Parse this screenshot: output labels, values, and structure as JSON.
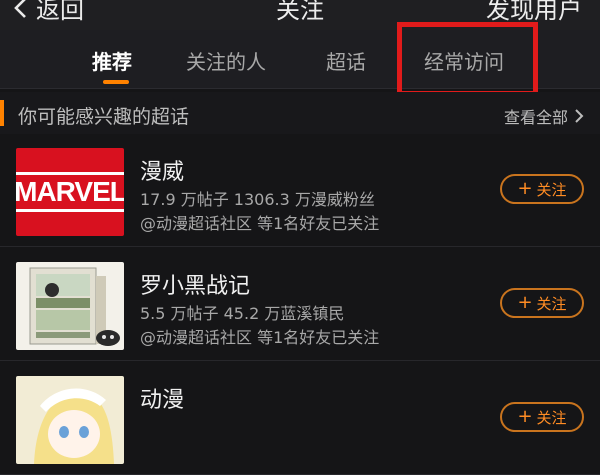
{
  "header": {
    "back_label": "返回",
    "title": "关注",
    "discover_label": "发现用户"
  },
  "tabs": [
    {
      "label": "推荐",
      "active": true
    },
    {
      "label": "关注的人",
      "active": false
    },
    {
      "label": "超话",
      "active": false
    },
    {
      "label": "经常访问",
      "active": false
    }
  ],
  "section": {
    "title": "你可能感兴趣的超话",
    "more_label": "查看全部"
  },
  "items": [
    {
      "name": "漫威",
      "stats": "17.9 万帖子 1306.3 万漫威粉丝",
      "social": "@动漫超话社区 等1名好友已关注",
      "follow_label": "关注",
      "thumb_text": "MARVEL"
    },
    {
      "name": "罗小黑战记",
      "stats": "5.5 万帖子 45.2 万蓝溪镇民",
      "social": "@动漫超话社区 等1名好友已关注",
      "follow_label": "关注",
      "thumb_text": ""
    },
    {
      "name": "动漫",
      "stats": "",
      "social": "",
      "follow_label": "关注",
      "thumb_text": ""
    }
  ],
  "colors": {
    "accent": "#ff8200",
    "highlight": "#e11b1b",
    "background": "#151517",
    "marvel_red": "#d8111f"
  },
  "icons": {
    "back": "chevron-left-icon",
    "more": "chevron-right-icon",
    "follow": "plus-icon"
  }
}
